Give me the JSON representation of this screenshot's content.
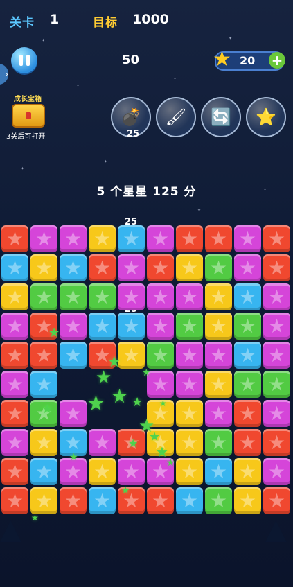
{
  "hud": {
    "level_label": "关卡",
    "level_value": "1",
    "goal_label": "目标",
    "goal_value": "1000",
    "score": "50",
    "star_count": "20",
    "plus_label": "+"
  },
  "chest": {
    "title": "成长宝箱",
    "note": "3关后可打开"
  },
  "tools": [
    {
      "name": "bomb",
      "glyph": "💣"
    },
    {
      "name": "brush",
      "glyph": "🖌"
    },
    {
      "name": "swap",
      "glyph": "🔄"
    },
    {
      "name": "star-box",
      "glyph": "⭐"
    }
  ],
  "tool_badge": "25",
  "message": "5 个星星 125 分",
  "floating_scores": [
    "25",
    "25"
  ],
  "board": {
    "rows": [
      [
        "red",
        "purple",
        "purple",
        "yellow",
        "blue",
        "purple",
        "red",
        "red",
        "purple",
        "red"
      ],
      [
        "blue",
        "yellow",
        "blue",
        "red",
        "purple",
        "red",
        "yellow",
        "green",
        "purple",
        "red"
      ],
      [
        "yellow",
        "green",
        "green",
        "green",
        "purple",
        "purple",
        "purple",
        "yellow",
        "blue",
        "purple"
      ],
      [
        "purple",
        "red",
        "purple",
        "blue",
        "blue",
        "purple",
        "green",
        "yellow",
        "green",
        "purple"
      ],
      [
        "red",
        "red",
        "blue",
        "red",
        "yellow",
        "green",
        "purple",
        "purple",
        "blue",
        "purple"
      ],
      [
        "purple",
        "blue",
        null,
        null,
        null,
        "purple",
        "purple",
        "yellow",
        "green",
        "green"
      ],
      [
        "red",
        "green",
        "purple",
        null,
        null,
        "yellow",
        "yellow",
        "purple",
        "red",
        "purple"
      ],
      [
        "purple",
        "yellow",
        "blue",
        "purple",
        "red",
        "yellow",
        "yellow",
        "green",
        "red",
        "red"
      ],
      [
        "red",
        "blue",
        "purple",
        "yellow",
        "purple",
        "purple",
        "yellow",
        "blue",
        "yellow",
        "purple"
      ],
      [
        "red",
        "yellow",
        "red",
        "blue",
        "red",
        "red",
        "blue",
        "green",
        "yellow",
        "red"
      ]
    ]
  },
  "colors": {
    "red": "#f0482f",
    "purple": "#d545d9",
    "yellow": "#f7c81a",
    "blue": "#37b5f0",
    "green": "#52cb43"
  }
}
